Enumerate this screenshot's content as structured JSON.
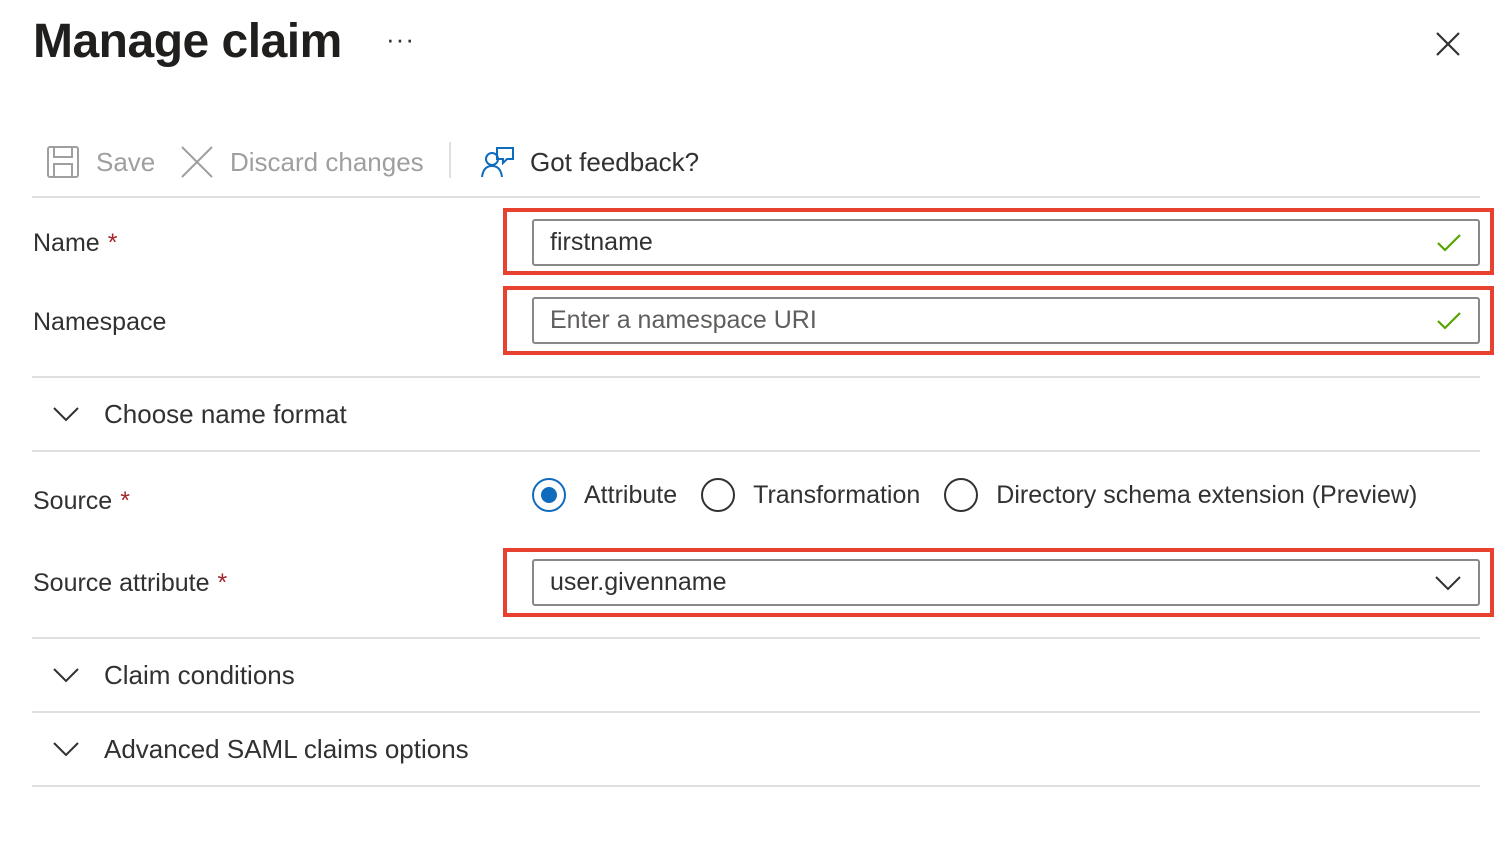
{
  "header": {
    "title": "Manage claim",
    "more_label": "···"
  },
  "toolbar": {
    "save_label": "Save",
    "discard_label": "Discard changes",
    "feedback_label": "Got feedback?"
  },
  "form": {
    "name": {
      "label": "Name",
      "required_mark": "*",
      "value": "firstname"
    },
    "namespace": {
      "label": "Namespace",
      "placeholder": "Enter a namespace URI",
      "value": ""
    },
    "name_format_section": "Choose name format",
    "source": {
      "label": "Source",
      "required_mark": "*",
      "options": [
        "Attribute",
        "Transformation",
        "Directory schema extension (Preview)"
      ],
      "selected": "Attribute"
    },
    "source_attribute": {
      "label": "Source attribute",
      "required_mark": "*",
      "value": "user.givenname"
    },
    "claim_conditions_section": "Claim conditions",
    "advanced_section": "Advanced SAML claims options"
  },
  "colors": {
    "accent": "#0f6cbd",
    "valid_check": "#57a300",
    "required": "#a4262c",
    "highlight": "#e8412f"
  }
}
